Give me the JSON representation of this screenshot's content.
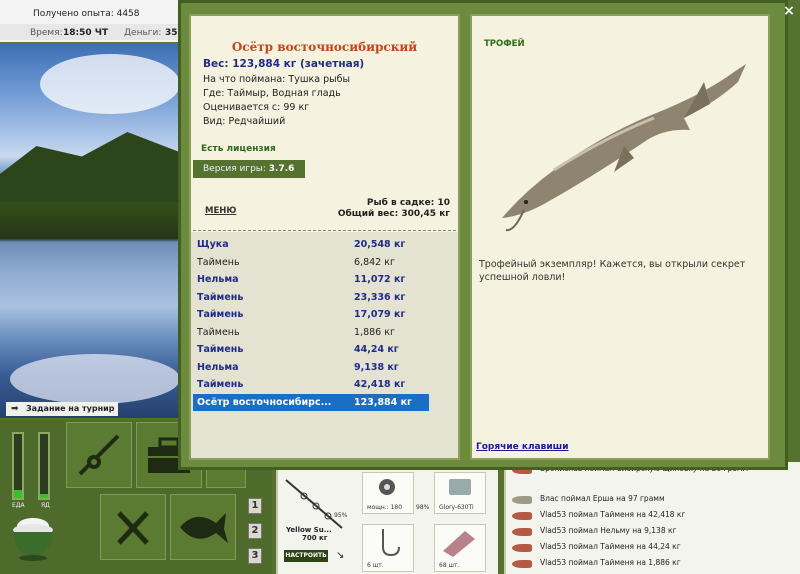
{
  "top": {
    "experience": "Получено опыта: 4458",
    "time_label": "Время:",
    "time_value": "18:50 ЧТ",
    "money_label": "Деньги:",
    "money_value": "35"
  },
  "tournament_label": "Задание на турнир",
  "gauges": [
    {
      "label": "ЕДА",
      "level": 0.12
    },
    {
      "label": "ЯД",
      "level": 0.06
    }
  ],
  "side_numbers": [
    "1",
    "2",
    "3"
  ],
  "gear": {
    "rod_name": "Yellow Su...",
    "rod_weight": "700 кг",
    "rod_percent": "95%",
    "setup_label": "НАСТРОИТЬ",
    "reel_caption": "мощн.: 180",
    "reel_percent": "98%",
    "line_name": "Glory-630Ti",
    "hook_count": "6 шт.",
    "bait_count": "68 шт."
  },
  "chat_log": [
    "Бронислав поймал Сибирскую щиповку на 20 грамм",
    "Влас поймал Ерша на 97 грамм",
    "Vlad53 поймал Тайменя на 42,418 кг",
    "Vlad53 поймал Нельму на 9,138 кг",
    "Vlad53 поймал Тайменя на 44,24 кг",
    "Vlad53 поймал Тайменя на 1,886 кг"
  ],
  "dialog": {
    "close_glyph": "×",
    "fish_name": "Осётр восточносибирский",
    "weight": "Вес: 123,884 кг (зачетная)",
    "caught_on": "На что поймана: Тушка рыбы",
    "where": "Где: Таймыр, Водная гладь",
    "valued_from": "Оценивается с: 99 кг",
    "kind": "Вид: Редчайший",
    "license": "Есть лицензия",
    "version_label": "Версия игры: ",
    "version_value": "3.7.6",
    "menu_label": "МЕНЮ",
    "keep_count": "Рыб в садке: 10",
    "total_weight": "Общий вес: 300,45 кг",
    "catches": [
      {
        "name": "Щука",
        "weight": "20,548 кг",
        "style": "bold"
      },
      {
        "name": "Таймень",
        "weight": "6,842 кг",
        "style": "plain"
      },
      {
        "name": "Нельма",
        "weight": "11,072 кг",
        "style": "bold"
      },
      {
        "name": "Таймень",
        "weight": "23,336 кг",
        "style": "bold"
      },
      {
        "name": "Таймень",
        "weight": "17,079 кг",
        "style": "bold"
      },
      {
        "name": "Таймень",
        "weight": "1,886 кг",
        "style": "plain"
      },
      {
        "name": "Таймень",
        "weight": "44,24 кг",
        "style": "bold"
      },
      {
        "name": "Нельма",
        "weight": "9,138 кг",
        "style": "bold"
      },
      {
        "name": "Таймень",
        "weight": "42,418 кг",
        "style": "bold"
      },
      {
        "name": "Осётр восточносибирс...",
        "weight": "123,884 кг",
        "style": "sel"
      }
    ],
    "trophy_heading": "ТРОФЕЙ",
    "trophy_text": "Трофейный экземпляр! Кажется, вы открыли секрет успешной ловли!",
    "hotkeys": "Горячие клавиши"
  }
}
